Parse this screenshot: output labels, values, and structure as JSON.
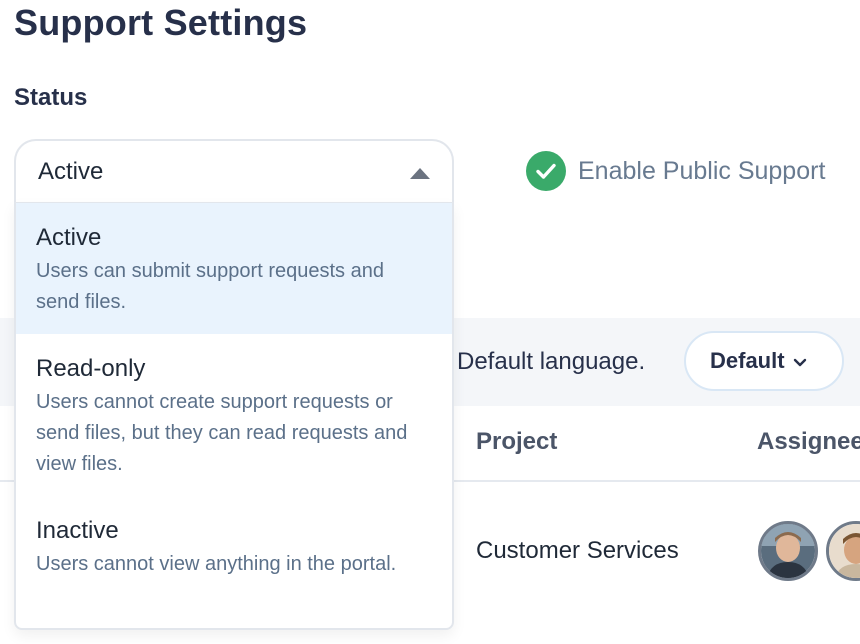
{
  "page": {
    "title": "Support Settings"
  },
  "status": {
    "label": "Status",
    "selected_value": "Active",
    "options": [
      {
        "title": "Active",
        "description": "Users can submit support requests and send files.",
        "selected": true
      },
      {
        "title": "Read-only",
        "description": "Users cannot create support requests or send files, but they can read requests and view files.",
        "selected": false
      },
      {
        "title": "Inactive",
        "description": "Users cannot view anything in the portal.",
        "selected": false
      }
    ]
  },
  "public_support": {
    "label": "Enable Public Support",
    "checked": true,
    "icon": "check-circle-icon",
    "color": "#3aaa6a"
  },
  "language": {
    "text": "Default language.",
    "select_value": "Default",
    "icon": "chevron-down-icon"
  },
  "table": {
    "columns": [
      "Project",
      "Assignee"
    ],
    "rows": [
      {
        "project": "Customer Services"
      }
    ]
  },
  "colors": {
    "selected_option_bg": "#e9f3fd",
    "title": "#27304a",
    "description": "#5b7089"
  }
}
